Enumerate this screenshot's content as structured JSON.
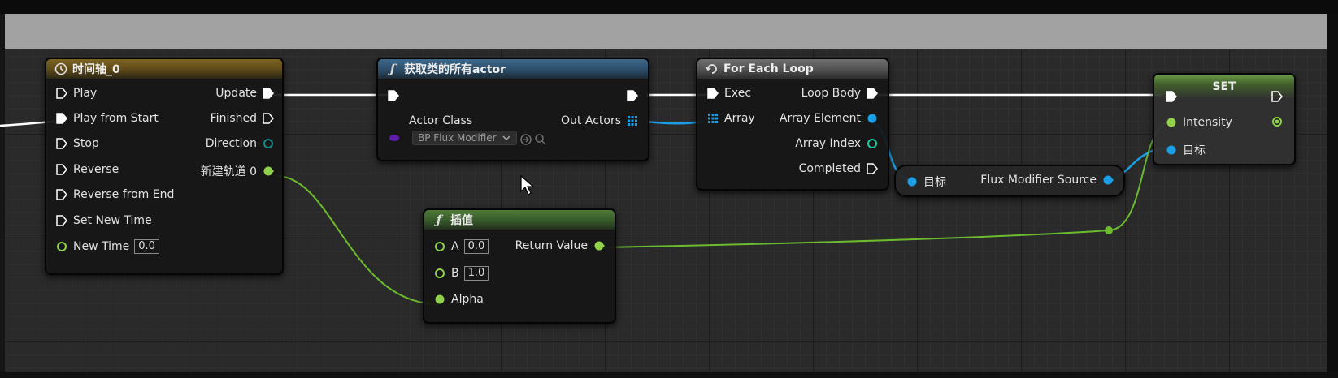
{
  "timeline_node": {
    "title": "时间轴_0",
    "inputs": [
      {
        "label": "Play"
      },
      {
        "label": "Play from Start"
      },
      {
        "label": "Stop"
      },
      {
        "label": "Reverse"
      },
      {
        "label": "Reverse from End"
      },
      {
        "label": "Set New Time"
      }
    ],
    "new_time": {
      "label": "New Time",
      "value": "0.0"
    },
    "outputs": [
      {
        "label": "Update"
      },
      {
        "label": "Finished"
      },
      {
        "label": "Direction"
      },
      {
        "label": "新建轨道 0"
      }
    ]
  },
  "get_all_actors_node": {
    "title": "获取类的所有actor",
    "actor_class_label": "Actor Class",
    "actor_class_value": "BP Flux Modifier",
    "out_actors_label": "Out Actors"
  },
  "for_each_node": {
    "title": "For Each Loop",
    "exec_label": "Exec",
    "array_label": "Array",
    "loop_body_label": "Loop Body",
    "array_element_label": "Array Element",
    "array_index_label": "Array Index",
    "completed_label": "Completed"
  },
  "lerp_node": {
    "title": "插值",
    "a_label": "A",
    "a_value": "0.0",
    "b_label": "B",
    "b_value": "1.0",
    "alpha_label": "Alpha",
    "return_label": "Return Value"
  },
  "get_source_node": {
    "target_label": "目标",
    "output_label": "Flux Modifier Source"
  },
  "set_node": {
    "title": "SET",
    "intensity_label": "Intensity",
    "target_label": "目标"
  },
  "colors": {
    "exec": "#ffffff",
    "float": "#8fd148",
    "object": "#1a9ee6",
    "class": "#5b1fa8",
    "struct": "#1a8a8a"
  },
  "icons": [
    "clock-icon",
    "function-icon",
    "loop-icon",
    "exec-pin-icon",
    "array-pin-icon",
    "data-pin-icon",
    "mouse-cursor-icon"
  ]
}
